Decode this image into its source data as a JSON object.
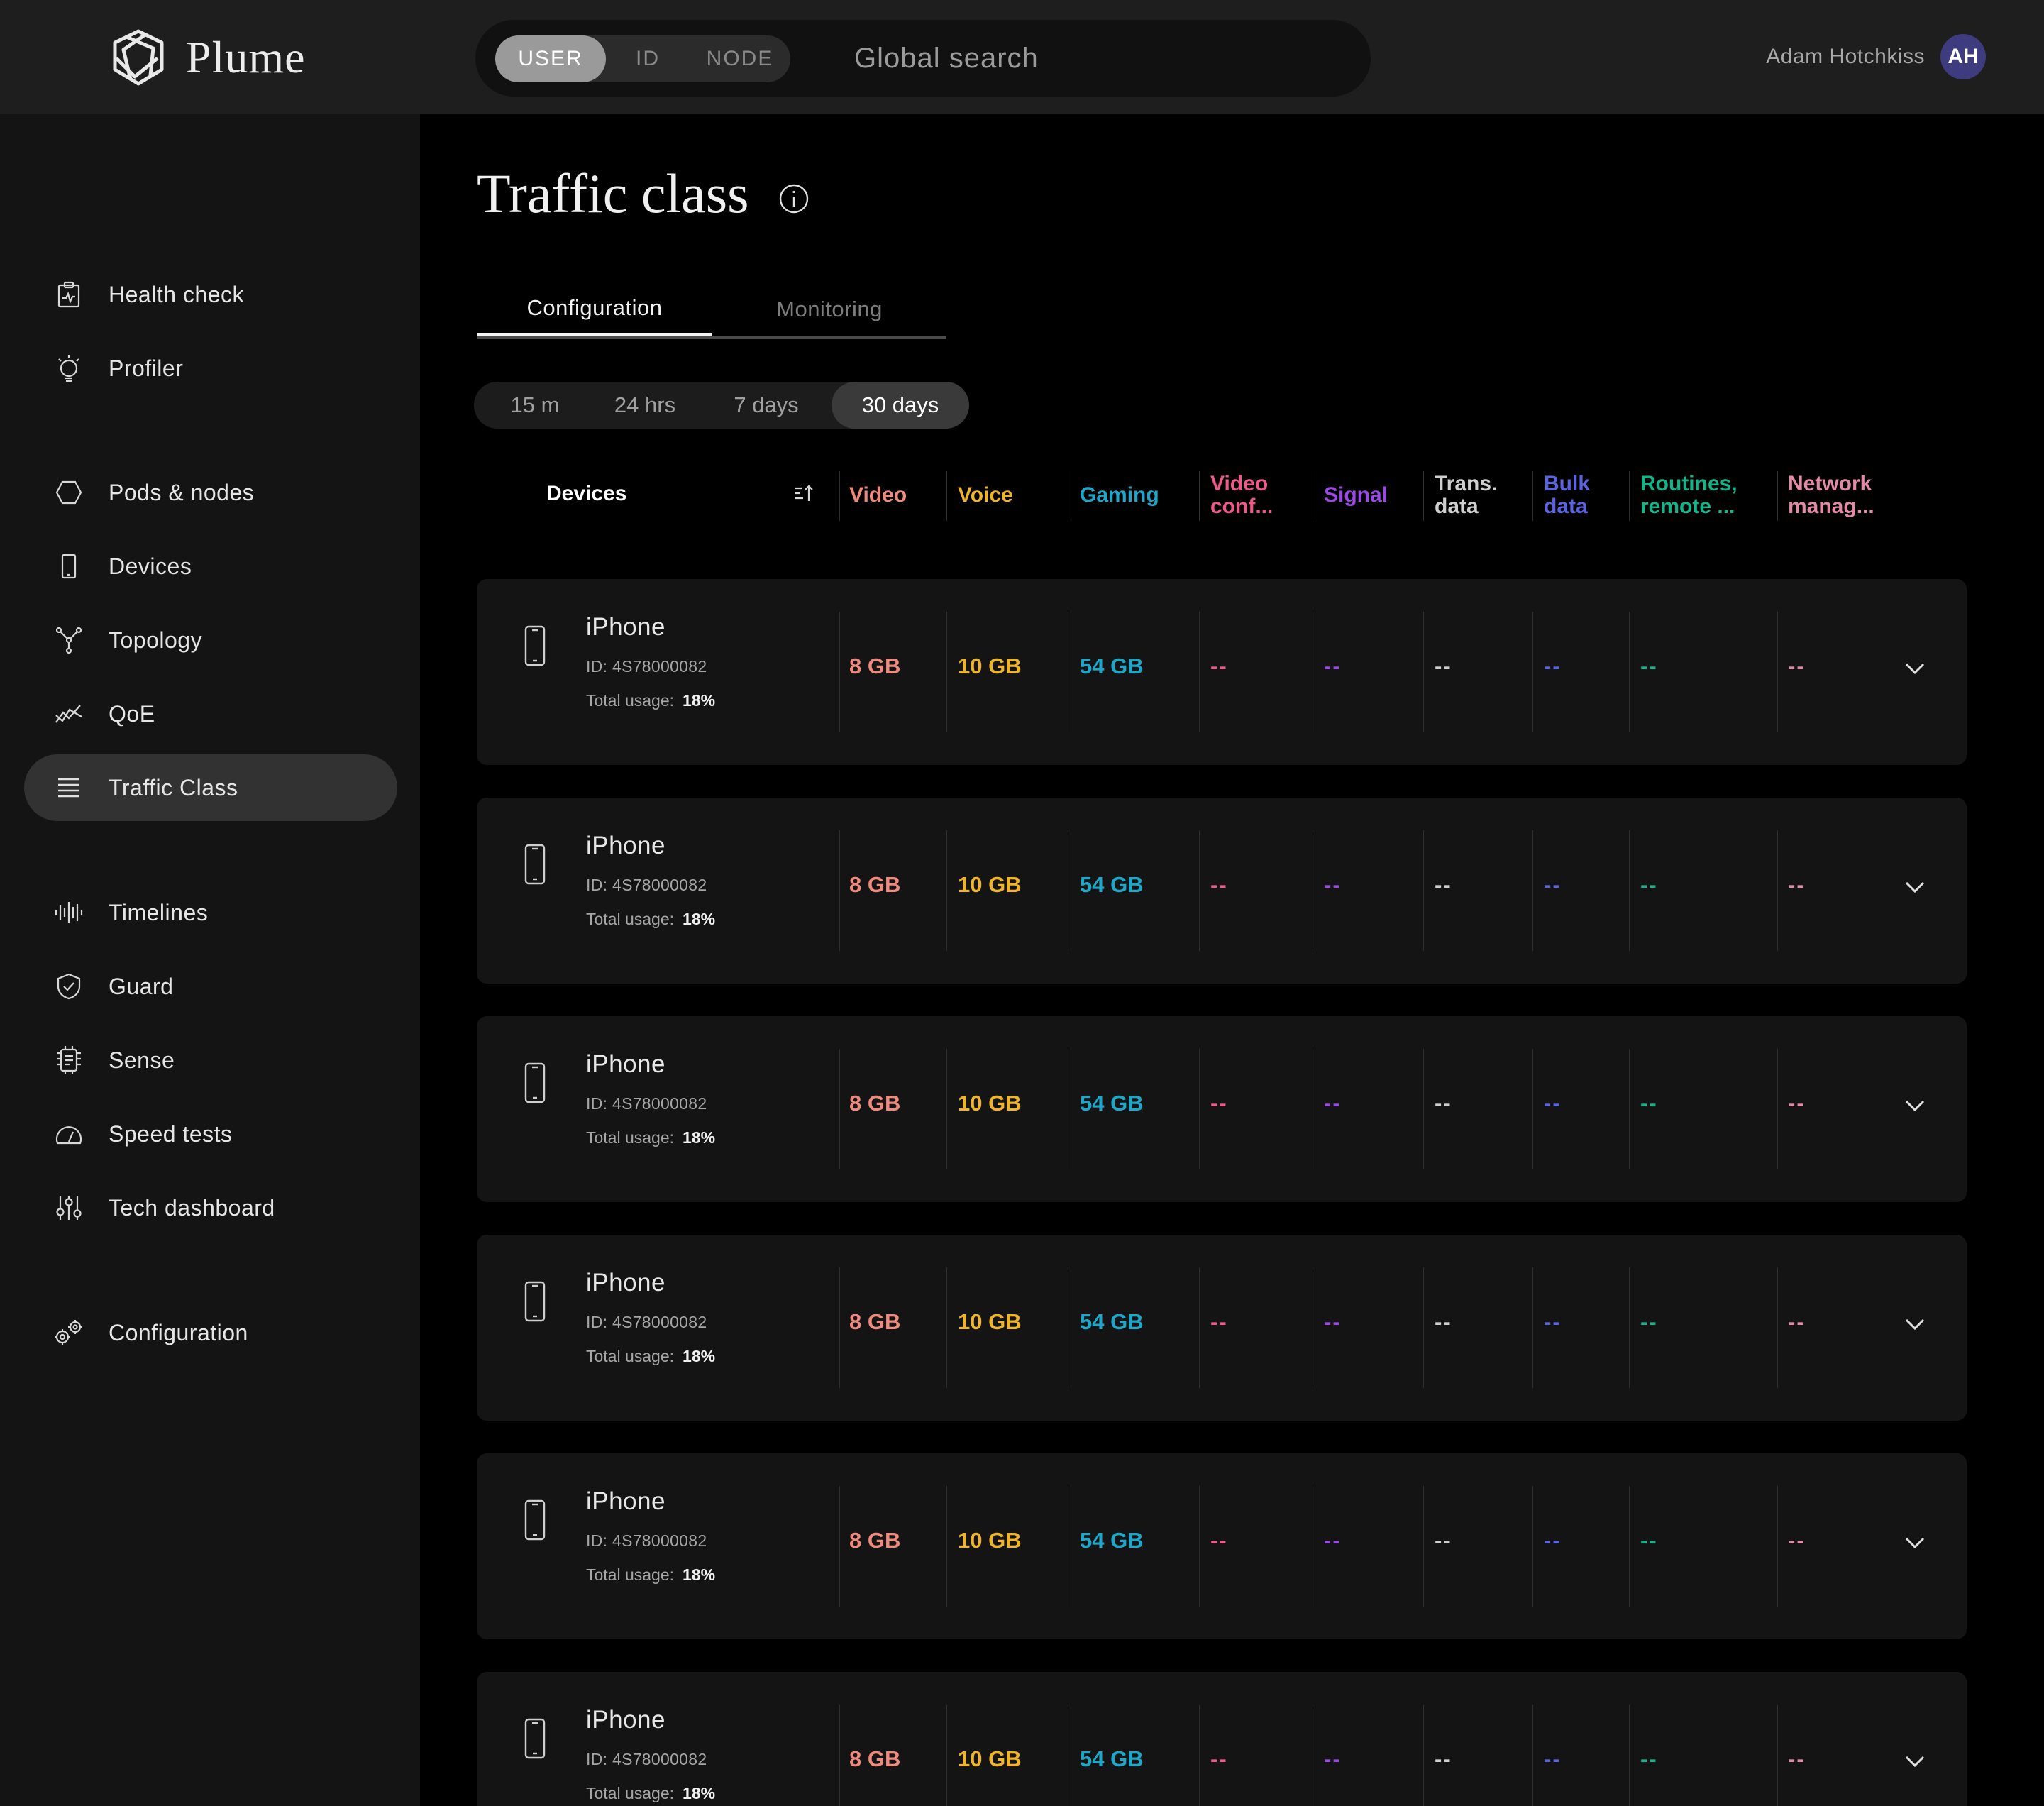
{
  "brand": {
    "name": "Plume"
  },
  "search": {
    "modes": [
      "USER",
      "ID",
      "NODE"
    ],
    "active_mode": "USER",
    "placeholder": "Global search"
  },
  "user": {
    "name": "Adam Hotchkiss",
    "initials": "AH"
  },
  "sidebar": {
    "items": [
      {
        "label": "Health check",
        "icon": "clipboard-heart-icon",
        "active": false
      },
      {
        "label": "Profiler",
        "icon": "lightbulb-icon",
        "active": false
      },
      {
        "label": "Pods & nodes",
        "icon": "hexagon-icon",
        "active": false
      },
      {
        "label": "Devices",
        "icon": "phone-icon",
        "active": false
      },
      {
        "label": "Topology",
        "icon": "topology-icon",
        "active": false
      },
      {
        "label": "QoE",
        "icon": "trend-icon",
        "active": false
      },
      {
        "label": "Traffic Class",
        "icon": "stack-lines-icon",
        "active": true
      },
      {
        "label": "Timelines",
        "icon": "waveform-icon",
        "active": false
      },
      {
        "label": "Guard",
        "icon": "shield-check-icon",
        "active": false
      },
      {
        "label": "Sense",
        "icon": "chip-icon",
        "active": false
      },
      {
        "label": "Speed tests",
        "icon": "speedometer-icon",
        "active": false
      },
      {
        "label": "Tech dashboard",
        "icon": "sliders-icon",
        "active": false
      },
      {
        "label": "Configuration",
        "icon": "gears-icon",
        "active": false
      }
    ]
  },
  "page": {
    "title": "Traffic class",
    "tabs": [
      {
        "label": "Configuration",
        "active": true
      },
      {
        "label": "Monitoring",
        "active": false
      }
    ],
    "ranges": [
      {
        "label": "15 m",
        "active": false
      },
      {
        "label": "24 hrs",
        "active": false
      },
      {
        "label": "7 days",
        "active": false
      },
      {
        "label": "30 days",
        "active": true
      }
    ]
  },
  "table": {
    "devices_header": "Devices",
    "columns": [
      {
        "line1": "Video",
        "line2": "",
        "color": "#f08a7e"
      },
      {
        "line1": "Voice",
        "line2": "",
        "color": "#f0b428"
      },
      {
        "line1": "Gaming",
        "line2": "",
        "color": "#1ea7c8"
      },
      {
        "line1": "Video",
        "line2": "conf...",
        "color": "#ee5a88"
      },
      {
        "line1": "Signal",
        "line2": "",
        "color": "#9a48e6"
      },
      {
        "line1": "Trans.",
        "line2": "data",
        "color": "#cfcfcf"
      },
      {
        "line1": "Bulk",
        "line2": "data",
        "color": "#5b63e0"
      },
      {
        "line1": "Routines,",
        "line2": "remote ...",
        "color": "#16b48a"
      },
      {
        "line1": "Network",
        "line2": "manag...",
        "color": "#e28aa8"
      }
    ],
    "rows": [
      {
        "name": "iPhone",
        "id": "ID: 4S78000082",
        "usage_label": "Total usage:",
        "usage": "18%",
        "values": [
          "8 GB",
          "10 GB",
          "54 GB",
          "--",
          "--",
          "--",
          "--",
          "--",
          "--"
        ]
      },
      {
        "name": "iPhone",
        "id": "ID: 4S78000082",
        "usage_label": "Total usage:",
        "usage": "18%",
        "values": [
          "8 GB",
          "10 GB",
          "54 GB",
          "--",
          "--",
          "--",
          "--",
          "--",
          "--"
        ]
      },
      {
        "name": "iPhone",
        "id": "ID: 4S78000082",
        "usage_label": "Total usage:",
        "usage": "18%",
        "values": [
          "8 GB",
          "10 GB",
          "54 GB",
          "--",
          "--",
          "--",
          "--",
          "--",
          "--"
        ]
      },
      {
        "name": "iPhone",
        "id": "ID: 4S78000082",
        "usage_label": "Total usage:",
        "usage": "18%",
        "values": [
          "8 GB",
          "10 GB",
          "54 GB",
          "--",
          "--",
          "--",
          "--",
          "--",
          "--"
        ]
      },
      {
        "name": "iPhone",
        "id": "ID: 4S78000082",
        "usage_label": "Total usage:",
        "usage": "18%",
        "values": [
          "8 GB",
          "10 GB",
          "54 GB",
          "--",
          "--",
          "--",
          "--",
          "--",
          "--"
        ]
      },
      {
        "name": "iPhone",
        "id": "ID: 4S78000082",
        "usage_label": "Total usage:",
        "usage": "18%",
        "values": [
          "8 GB",
          "10 GB",
          "54 GB",
          "--",
          "--",
          "--",
          "--",
          "--",
          "--"
        ]
      }
    ]
  }
}
